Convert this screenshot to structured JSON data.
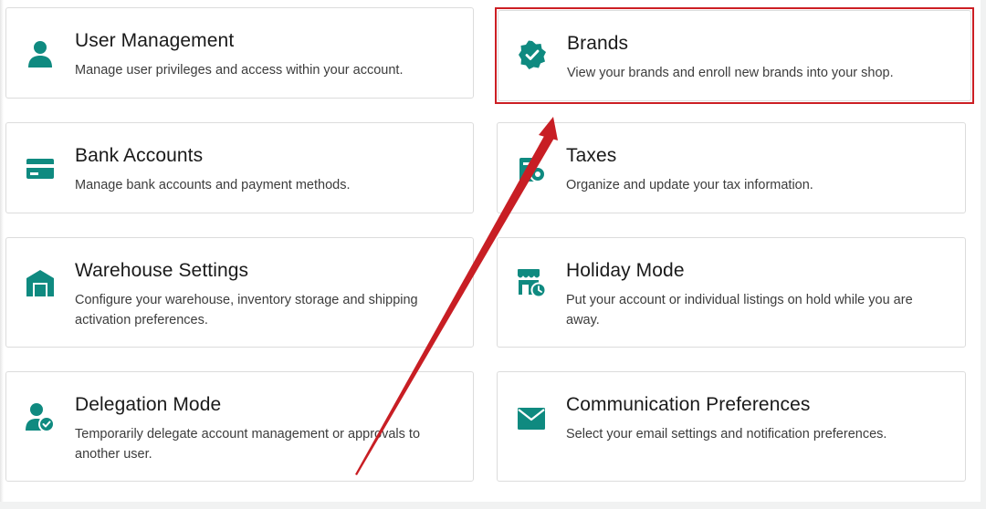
{
  "cards": [
    {
      "title": "User Management",
      "description": "Manage user privileges and access within your account.",
      "icon": "user-icon"
    },
    {
      "title": "Brands",
      "description": "View your brands and enroll new brands into your shop.",
      "icon": "verified-badge-icon"
    },
    {
      "title": "Bank Accounts",
      "description": "Manage bank accounts and payment methods.",
      "icon": "credit-card-icon"
    },
    {
      "title": "Taxes",
      "description": "Organize and update your tax information.",
      "icon": "tax-icon"
    },
    {
      "title": "Warehouse Settings",
      "description": "Configure your warehouse, inventory storage and shipping activation preferences.",
      "icon": "warehouse-icon"
    },
    {
      "title": "Holiday Mode",
      "description": "Put your account or individual listings on hold while you are away.",
      "icon": "store-clock-icon"
    },
    {
      "title": "Delegation Mode",
      "description": "Temporarily delegate account management or approvals to another user.",
      "icon": "user-check-icon"
    },
    {
      "title": "Communication Preferences",
      "description": "Select your email settings and notification preferences.",
      "icon": "envelope-icon"
    }
  ],
  "colors": {
    "icon": "#0f8a80",
    "highlight": "#cc1f24",
    "arrow": "#c81e24"
  }
}
